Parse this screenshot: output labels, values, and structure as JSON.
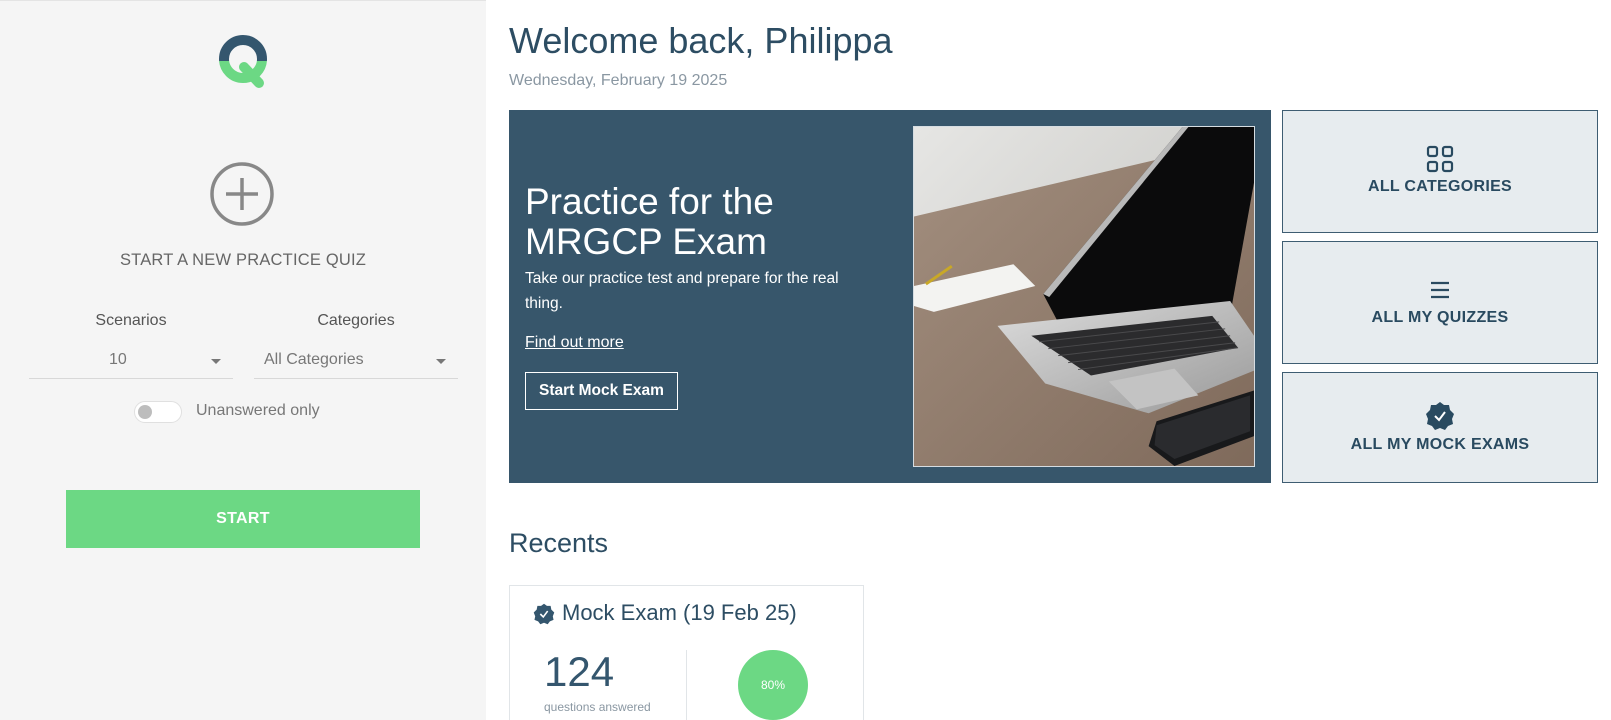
{
  "sidebar": {
    "new_quiz_label": "START A NEW PRACTICE QUIZ",
    "scenarios_label": "Scenarios",
    "scenarios_value": "10",
    "categories_label": "Categories",
    "categories_value": "All Categories",
    "unanswered_label": "Unanswered only",
    "unanswered_enabled": false,
    "start_label": "START"
  },
  "header": {
    "welcome": "Welcome back, Philippa",
    "date": "Wednesday, February 19 2025"
  },
  "hero": {
    "title": "Practice for the MRGCP Exam",
    "text": "Take our practice test and prepare for the real thing.",
    "link": "Find out more",
    "button": "Start Mock Exam"
  },
  "tiles": [
    {
      "label": "ALL CATEGORIES",
      "icon": "grid-icon"
    },
    {
      "label": "ALL MY QUIZZES",
      "icon": "list-icon"
    },
    {
      "label": "ALL MY MOCK EXAMS",
      "icon": "badge-check-icon"
    }
  ],
  "recents": {
    "title": "Recents",
    "cards": [
      {
        "title": "Mock Exam (19 Feb 25)",
        "count": "124",
        "count_label": "questions answered",
        "score": "80%"
      }
    ]
  },
  "colors": {
    "accent_green": "#6cd884",
    "navy": "#37566b",
    "tile_bg": "#e7ecef"
  }
}
